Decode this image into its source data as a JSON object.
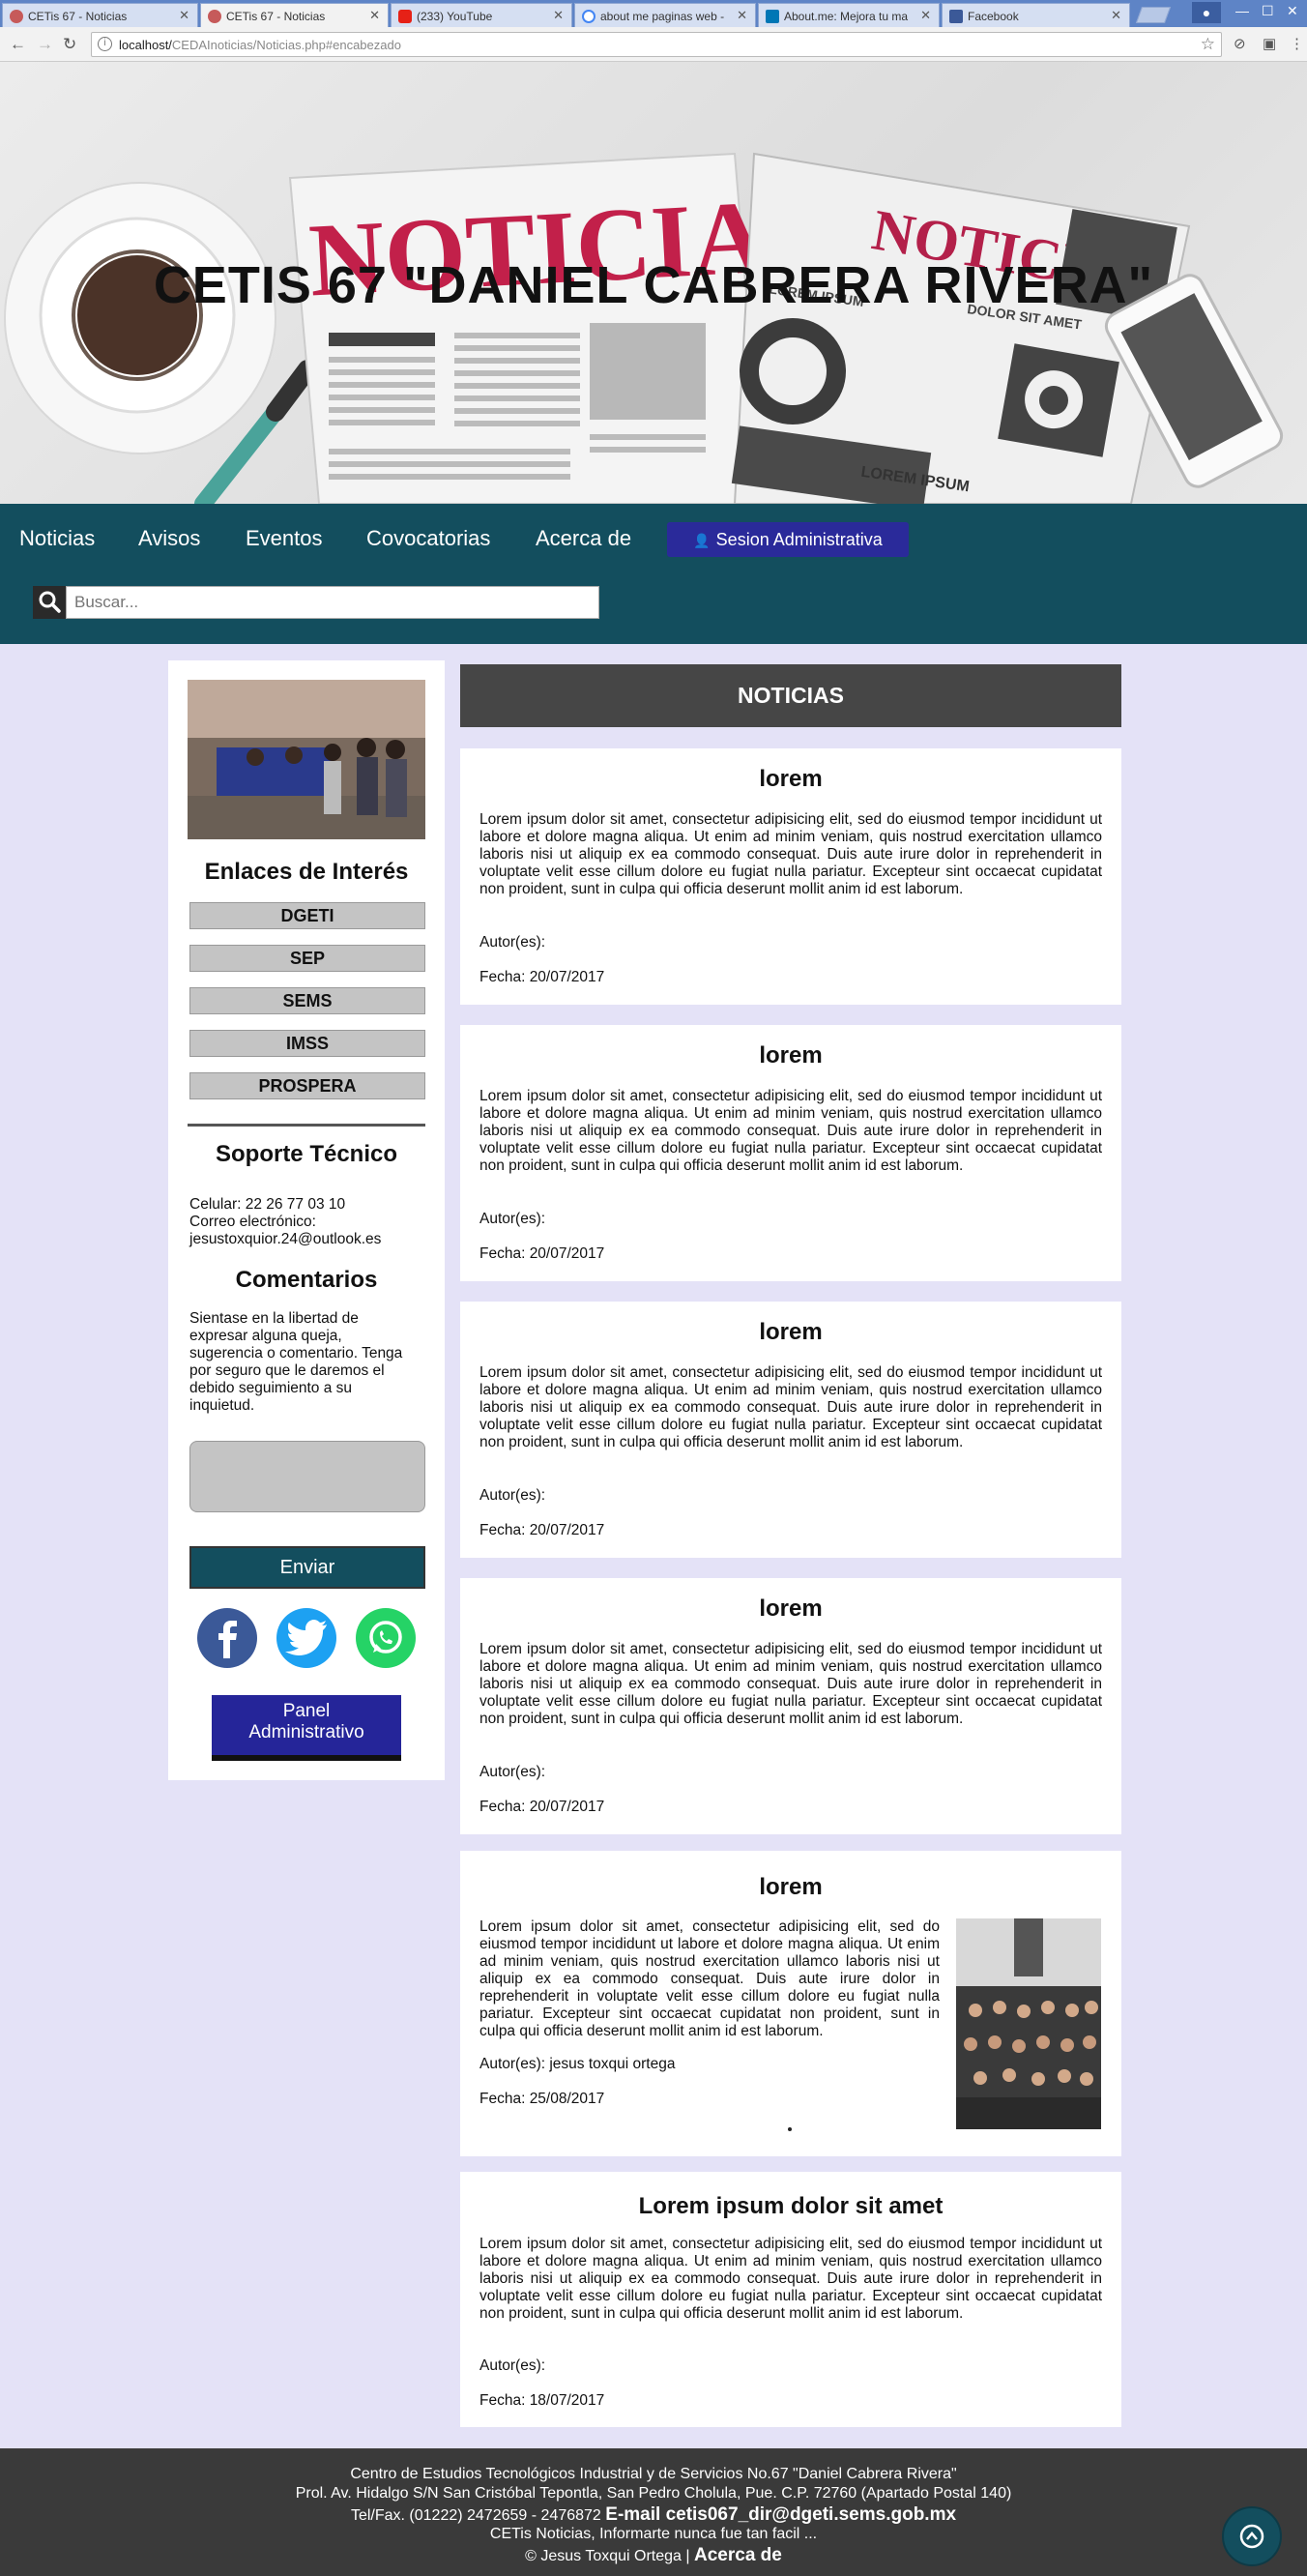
{
  "browser": {
    "tabs": [
      {
        "title": "CETis 67 - Noticias",
        "active": false,
        "favicon": "cetis-favicon-icon"
      },
      {
        "title": "CETis 67 - Noticias",
        "active": true,
        "favicon": "cetis-favicon-icon"
      },
      {
        "title": "(233) YouTube",
        "active": false,
        "favicon": "youtube-icon"
      },
      {
        "title": "about me paginas web -",
        "active": false,
        "favicon": "google-icon"
      },
      {
        "title": "About.me: Mejora tu ma",
        "active": false,
        "favicon": "linkedin-icon"
      },
      {
        "title": "Facebook",
        "active": false,
        "favicon": "facebook-icon"
      }
    ],
    "url_host": "localhost/",
    "url_path": "CEDAInoticias/Noticias.php#encabezado"
  },
  "header": {
    "title": "CETIS 67 \"DANIEL CABRERA RIVERA\"",
    "banner_text_left": "NOTICIAS",
    "banner_text_right": "NOTICIAS",
    "banner_small_1": "LOREM IPSUM",
    "banner_small_2": "LOREM IPSUM",
    "banner_small_3": "DOLOR SIT AMET"
  },
  "nav": {
    "items": [
      "Noticias",
      "Avisos",
      "Eventos",
      "Covocatorias",
      "Acerca de"
    ],
    "sesion_label": "Sesion Administrativa",
    "search_placeholder": "Buscar..."
  },
  "sidebar": {
    "links_heading": "Enlaces de Interés",
    "links": [
      "DGETI",
      "SEP",
      "SEMS",
      "IMSS",
      "PROSPERA"
    ],
    "support_heading": "Soporte Técnico",
    "support_phone": "Celular: 22 26 77 03 10",
    "support_email_label": "Correo electrónico:",
    "support_email": "jesustoxquior.24@outlook.es",
    "comments_heading": "Comentarios",
    "comments_text_lines": [
      "Sientase en la libertad de",
      "expresar alguna queja,",
      "sugerencia o comentario. Tenga",
      "por seguro que le daremos el",
      "debido seguimiento a su",
      "inquietud."
    ],
    "send_label": "Enviar",
    "panel_label_1": "Panel",
    "panel_label_2": "Administrativo"
  },
  "main": {
    "heading": "NOTICIAS",
    "articles": [
      {
        "title": "lorem",
        "body": "Lorem ipsum dolor sit amet, consectetur adipisicing elit, sed do eiusmod tempor incididunt ut labore et dolore magna aliqua. Ut enim ad minim veniam, quis nostrud exercitation ullamco laboris nisi ut aliquip ex ea commodo consequat. Duis aute irure dolor in reprehenderit in voluptate velit esse cillum dolore eu fugiat nulla pariatur. Excepteur sint occaecat cupidatat non proident, sunt in culpa qui officia deserunt mollit anim id est laborum.",
        "autor": "Autor(es):",
        "fecha": "Fecha: 20/07/2017"
      },
      {
        "title": "lorem",
        "body": "Lorem ipsum dolor sit amet, consectetur adipisicing elit, sed do eiusmod tempor incididunt ut labore et dolore magna aliqua. Ut enim ad minim veniam, quis nostrud exercitation ullamco laboris nisi ut aliquip ex ea commodo consequat. Duis aute irure dolor in reprehenderit in voluptate velit esse cillum dolore eu fugiat nulla pariatur. Excepteur sint occaecat cupidatat non proident, sunt in culpa qui officia deserunt mollit anim id est laborum.",
        "autor": "Autor(es):",
        "fecha": "Fecha: 20/07/2017"
      },
      {
        "title": "lorem",
        "body": "Lorem ipsum dolor sit amet, consectetur adipisicing elit, sed do eiusmod tempor incididunt ut labore et dolore magna aliqua. Ut enim ad minim veniam, quis nostrud exercitation ullamco laboris nisi ut aliquip ex ea commodo consequat. Duis aute irure dolor in reprehenderit in voluptate velit esse cillum dolore eu fugiat nulla pariatur. Excepteur sint occaecat cupidatat non proident, sunt in culpa qui officia deserunt mollit anim id est laborum.",
        "autor": "Autor(es):",
        "fecha": "Fecha: 20/07/2017"
      },
      {
        "title": "lorem",
        "body": "Lorem ipsum dolor sit amet, consectetur adipisicing elit, sed do eiusmod tempor incididunt ut labore et dolore magna aliqua. Ut enim ad minim veniam, quis nostrud exercitation ullamco laboris nisi ut aliquip ex ea commodo consequat. Duis aute irure dolor in reprehenderit in voluptate velit esse cillum dolore eu fugiat nulla pariatur. Excepteur sint occaecat cupidatat non proident, sunt in culpa qui officia deserunt mollit anim id est laborum.",
        "autor": "Autor(es):",
        "fecha": "Fecha: 20/07/2017"
      },
      {
        "title": "lorem",
        "body": "Lorem ipsum dolor sit amet, consectetur adipisicing elit, sed do eiusmod tempor incididunt ut labore et dolore magna aliqua. Ut enim ad minim veniam, quis nostrud exercitation ullamco laboris nisi ut aliquip ex ea commodo consequat. Duis aute irure dolor in reprehenderit in voluptate velit esse cillum dolore eu fugiat nulla pariatur. Excepteur sint occaecat cupidatat non proident, sunt in culpa qui officia deserunt mollit anim id est laborum.",
        "autor": "Autor(es): jesus toxqui ortega",
        "fecha": "Fecha: 25/08/2017"
      },
      {
        "title": "Lorem ipsum dolor sit amet",
        "body": "Lorem ipsum dolor sit amet, consectetur adipisicing elit, sed do eiusmod tempor incididunt ut labore et dolore magna aliqua. Ut enim ad minim veniam, quis nostrud exercitation ullamco laboris nisi ut aliquip ex ea commodo consequat. Duis aute irure dolor in reprehenderit in voluptate velit esse cillum dolore eu fugiat nulla pariatur. Excepteur sint occaecat cupidatat non proident, sunt in culpa qui officia deserunt mollit anim id est laborum.",
        "autor": "Autor(es):",
        "fecha": "Fecha: 18/07/2017"
      }
    ]
  },
  "footer": {
    "line1": "Centro de Estudios Tecnológicos Industrial y de Servicios No.67 \"Daniel Cabrera Rivera\"",
    "line2": "Prol. Av. Hidalgo S/N San Cristóbal Tepontla, San Pedro Cholula, Pue. C.P. 72760 (Apartado Postal 140)",
    "line3_phone": "Tel/Fax. (01222) 2472659 - 2476872",
    "line3_email": "E-mail cetis067_dir@dgeti.sems.gob.mx",
    "line4": "CETis Noticias, Informarte nunca fue tan facil ...",
    "line5_copy": "© Jesus Toxqui Ortega |",
    "line5_link": "Acerca de"
  },
  "colors": {
    "page_bg": "#e4e2f7",
    "nav_bg": "#134e5e",
    "session_button": "#2a2a9a",
    "footer_bg": "#3a3a3a"
  }
}
